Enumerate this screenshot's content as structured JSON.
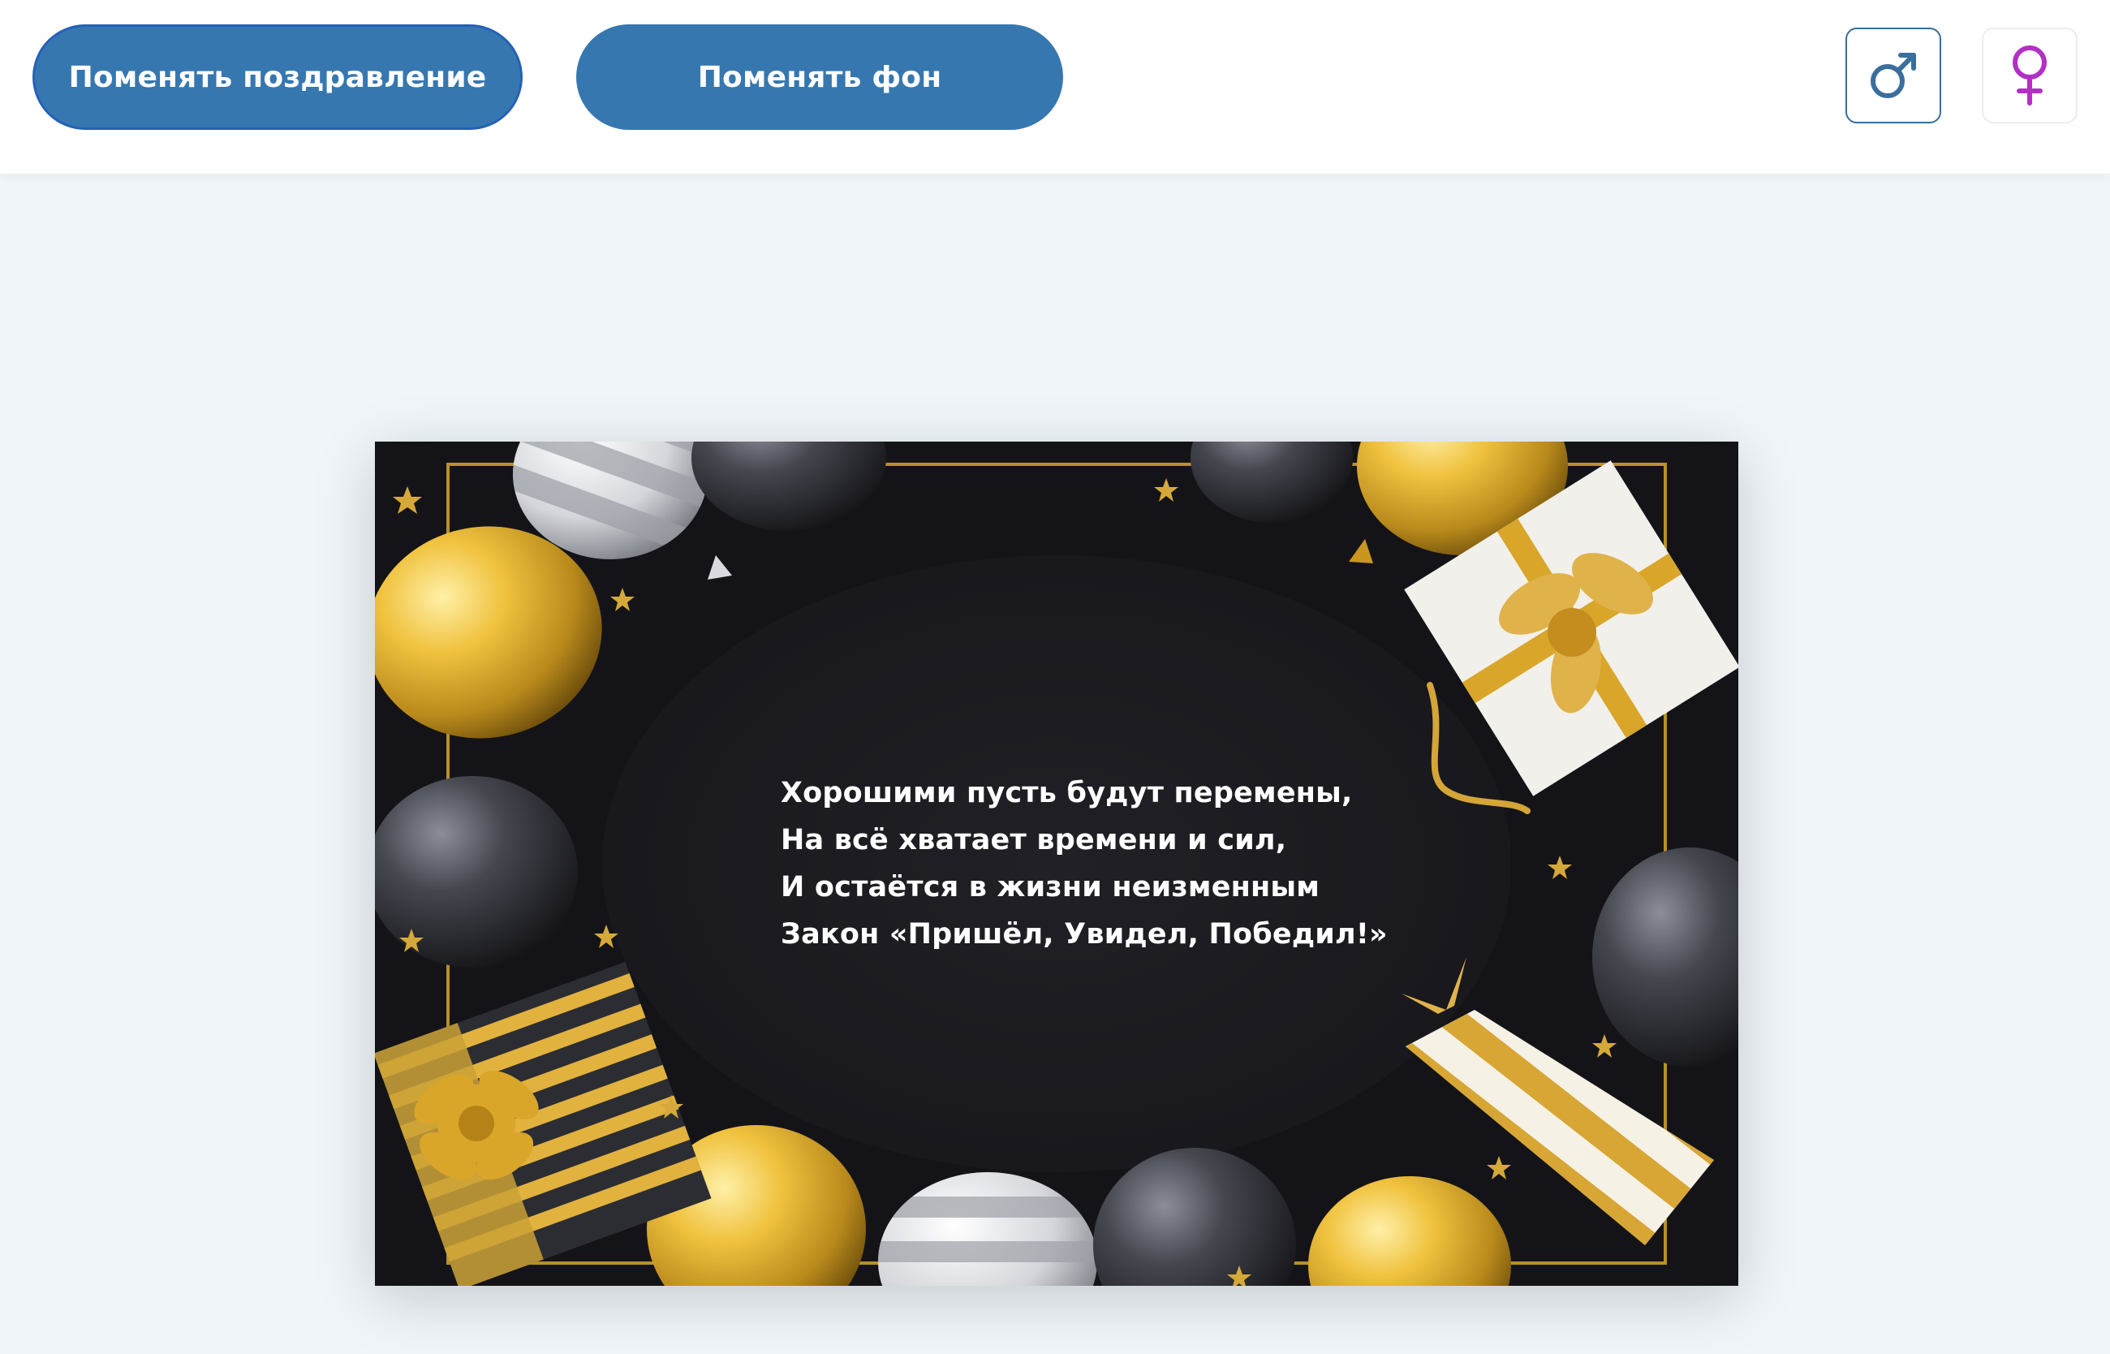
{
  "toolbar": {
    "change_greeting_label": "Поменять поздравление",
    "change_background_label": "Поменять фон"
  },
  "gender": {
    "male_icon": "male-symbol-icon",
    "female_icon": "female-symbol-icon",
    "male_color": "#3a6e9c",
    "female_color": "#b230c4"
  },
  "card": {
    "background": "black-and-gold-birthday-balloons",
    "poem_lines": [
      "Хорошими пусть будут перемены,",
      "На всё хватает времени и сил,",
      "И остаётся в жизни неизменным",
      "Закон «Пришёл, Увидел, Победил!»"
    ]
  },
  "colors": {
    "accent": "#3677b0",
    "page_background": "#eff5f9",
    "header_background": "#ffffff"
  }
}
